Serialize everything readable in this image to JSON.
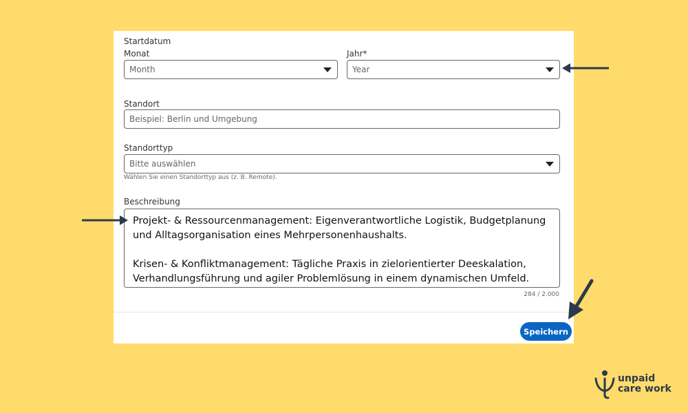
{
  "form": {
    "start_date_heading": "Startdatum",
    "month_label": "Monat",
    "month_value": "Month",
    "year_label": "Jahr*",
    "year_value": "Year",
    "location_label": "Standort",
    "location_placeholder": "Beispiel: Berlin und Umgebung",
    "location_type_label": "Standorttyp",
    "location_type_value": "Bitte auswählen",
    "location_type_hint": "Wählen Sie einen Standorttyp aus (z. B. Remote).",
    "description_label": "Beschreibung",
    "description_paragraph_1": "Projekt- & Ressourcenmanagement: Eigenverantwortliche Logistik, Budgetplanung und Alltagsorganisation eines Mehrpersonenhaushalts.",
    "description_paragraph_2": "Krisen- & Konfliktmanagement: Tägliche Praxis in zielorientierter Deeskalation, Verhandlungsführung und agiler Problemlösung in einem dynamischen Umfeld.",
    "char_counter": "284 / 2.000",
    "save_label": "Speichern"
  },
  "brand": {
    "line_1": "unpaid",
    "line_2": "care work"
  },
  "colors": {
    "background": "#FFDB6B",
    "accent": "#0a66c2",
    "arrow": "#2b3a4a"
  },
  "icons": [
    "arrow-left-icon",
    "arrow-right-icon",
    "arrow-down-left-icon",
    "dropdown-caret-icon",
    "unpaid-care-work-logo"
  ]
}
